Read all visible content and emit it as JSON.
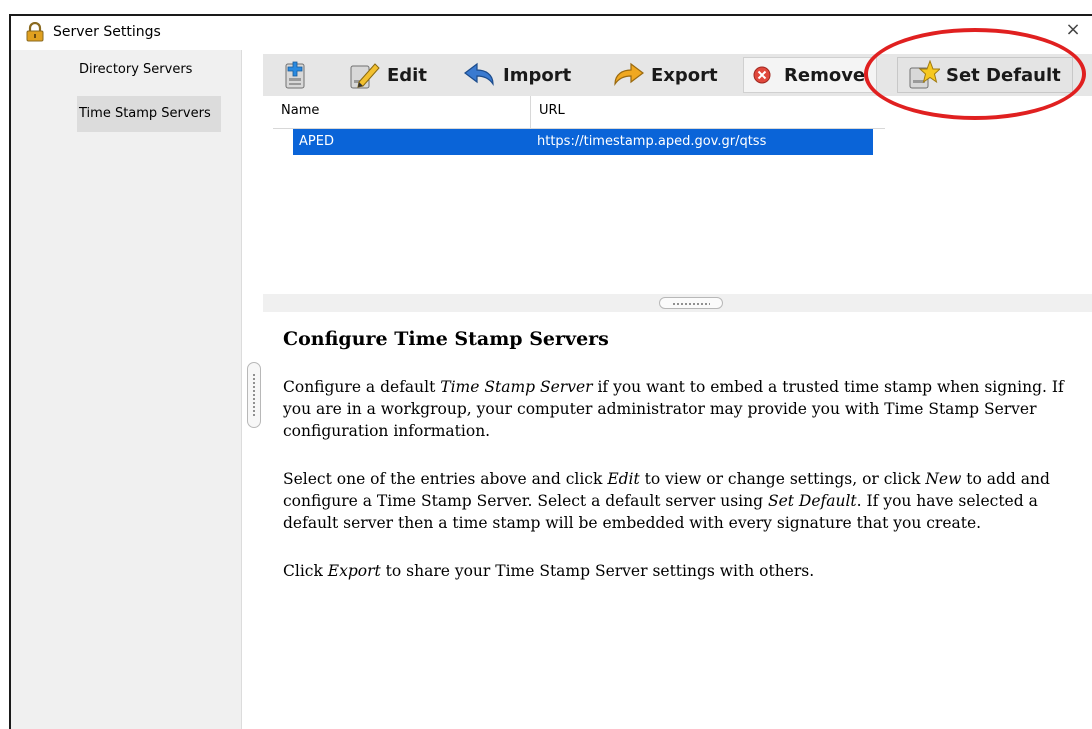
{
  "window": {
    "title": "Server Settings",
    "close_label": "×"
  },
  "sidebar": {
    "items": [
      {
        "label": "Directory Servers",
        "selected": false
      },
      {
        "label": "Time Stamp Servers",
        "selected": true
      }
    ]
  },
  "toolbar": {
    "new_label": "",
    "edit_label": "Edit",
    "import_label": "Import",
    "export_label": "Export",
    "remove_label": "Remove",
    "set_default_label": "Set Default"
  },
  "table": {
    "columns": [
      "Name",
      "URL"
    ],
    "rows": [
      {
        "name": "APED",
        "url": "https://timestamp.aped.gov.gr/qtss",
        "selected": true
      }
    ]
  },
  "help": {
    "title": "Configure Time Stamp Servers",
    "p1": {
      "a": "Configure a default ",
      "em1": "Time Stamp Server",
      "b": " if you want to embed a trusted time stamp when signing. If you are in a workgroup, your computer administrator may provide you with Time Stamp Server configuration information."
    },
    "p2": {
      "a": "Select one of the entries above and click ",
      "em1": "Edit",
      "b": " to view or change settings, or click ",
      "em2": "New",
      "c": " to add and configure a Time Stamp Server. Select a default server using ",
      "em3": "Set Default",
      "d": ". If you have selected a default server then a time stamp will be embedded with every signature that you create."
    },
    "p3": {
      "a": "Click ",
      "em1": "Export",
      "b": " to share your Time Stamp Server settings with others."
    }
  },
  "colors": {
    "selection": "#0a64d8",
    "highlight_ellipse": "#e02020"
  }
}
